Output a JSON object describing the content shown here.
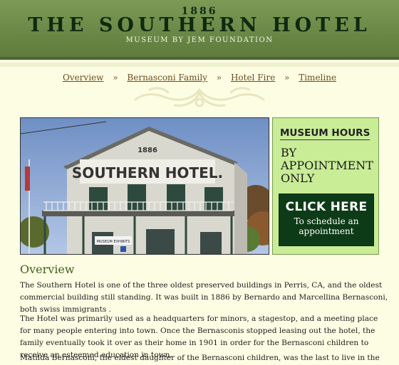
{
  "header": {
    "year": "1886",
    "title": "THE SOUTHERN HOTEL",
    "subtitle": "MUSEUM BY JEM FOUNDATION"
  },
  "nav": {
    "items": [
      {
        "label": "Overview"
      },
      {
        "label": "Bernasconi Family"
      },
      {
        "label": "Hotel Fire"
      },
      {
        "label": "Timeline"
      }
    ],
    "separator": "»"
  },
  "photo": {
    "sign_year": "1886",
    "sign_text": "SOUTHERN HOTEL.",
    "sign_small": "MUSEUM EXHIBITS"
  },
  "hours": {
    "title": "MUSEUM HOURS",
    "body": "BY APPOINTMENT ONLY",
    "cta_main": "CLICK HERE",
    "cta_sub": "To schedule an appointment"
  },
  "overview": {
    "title": "Overview",
    "paragraphs": [
      "The Southern Hotel is one of the three oldest preserved buildings in Perris, CA, and the oldest commercial building still standing. It was built in 1886 by Bernardo and Marcellina Bernasconi, both swiss immigrants .",
      "The Hotel was primarily used as a headquarters for minors, a stagestop, and a meeting place for many people entering into town. Once the Bernasconis stopped leasing out the hotel, the family eventually took it over as their home in 1901 in order for the Bernasconi children to receive an esteemed education in town.",
      "Matilda Bernasconi, the eldest daughter of the Bernasconi children, was the last to live in the hotel as a"
    ]
  },
  "colors": {
    "header_green": "#6a8746",
    "title_dark_green": "#0e2a10",
    "page_bg": "#fdfde4",
    "hours_bg": "#c9ec97",
    "cta_bg": "#0e3b17",
    "link_brown": "#6d4c1c",
    "heading_green": "#41601f"
  }
}
